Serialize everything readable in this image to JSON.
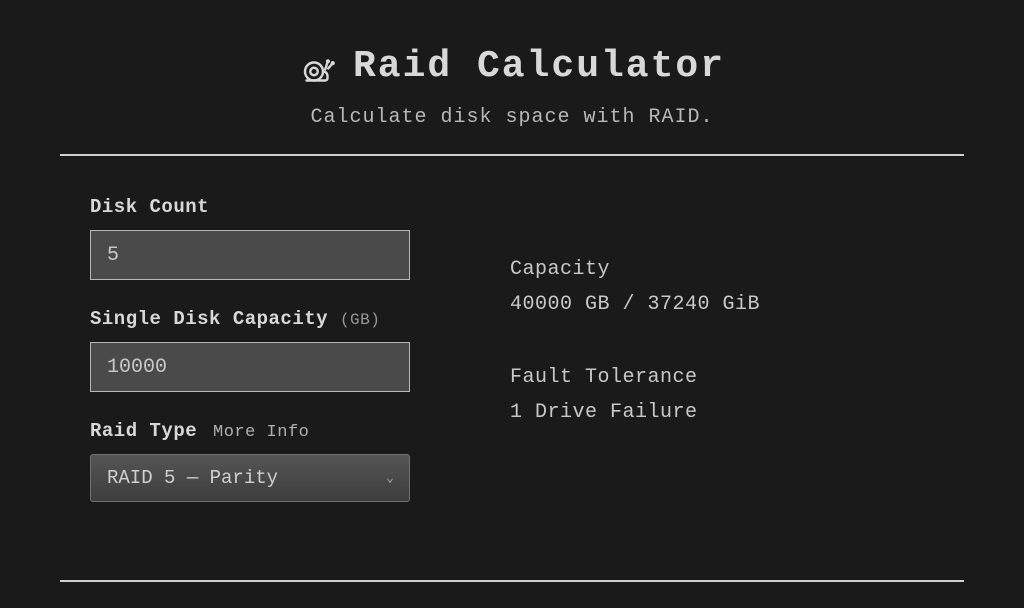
{
  "header": {
    "title": "Raid Calculator",
    "subtitle": "Calculate disk space with RAID."
  },
  "form": {
    "disk_count": {
      "label": "Disk Count",
      "value": "5"
    },
    "single_disk_capacity": {
      "label": "Single Disk Capacity",
      "suffix": "(GB)",
      "value": "10000"
    },
    "raid_type": {
      "label": "Raid Type",
      "more_info": "More Info",
      "value": "RAID 5 — Parity"
    }
  },
  "results": {
    "capacity": {
      "label": "Capacity",
      "value": "40000 GB / 37240 GiB"
    },
    "fault_tolerance": {
      "label": "Fault Tolerance",
      "value": "1 Drive Failure"
    }
  }
}
